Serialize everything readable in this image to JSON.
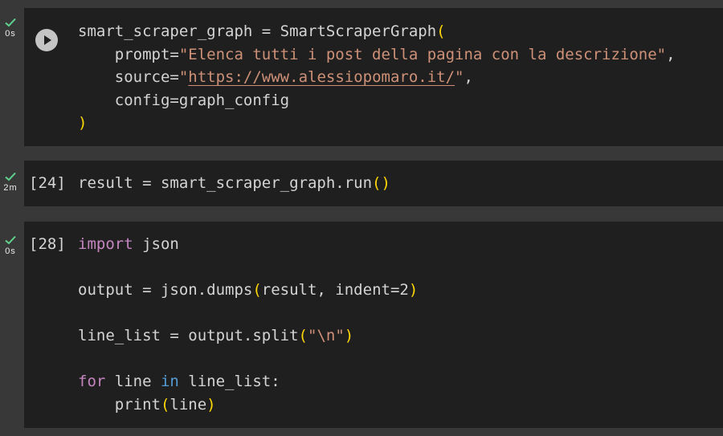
{
  "cells": [
    {
      "status": "0s",
      "exec_count": "",
      "lines": {
        "l1_var": "smart_scraper_graph",
        "l1_eq": " = ",
        "l1_cls": "SmartScraperGraph",
        "l1_paren": "(",
        "l2_arg": "    prompt=",
        "l2_str": "\"Elenca tutti i post della pagina con la descrizione\"",
        "l2_comma": ",",
        "l3_arg": "    source=",
        "l3_q1": "\"",
        "l3_url": "https://www.alessiopomaro.it/",
        "l3_q2": "\"",
        "l3_comma": ",",
        "l4": "    config=graph_config",
        "l5_paren": ")"
      }
    },
    {
      "status": "2m",
      "exec_count": "[24]",
      "lines": {
        "l1_code": "result = smart_scraper_graph.run",
        "l1_paren": "()"
      }
    },
    {
      "status": "0s",
      "exec_count": "[28]",
      "lines": {
        "l1_kw": "import",
        "l1_rest": " json",
        "l3_code": "output = json.dumps",
        "l3_p1": "(",
        "l3_args": "result, indent=2",
        "l3_p2": ")",
        "l5_code": "line_list = output.split",
        "l5_p1": "(",
        "l5_str": "\"\\n\"",
        "l5_p2": ")",
        "l7_for": "for",
        "l7_mid": " line ",
        "l7_in": "in",
        "l7_rest": " line_list:",
        "l8_code": "    print",
        "l8_p1": "(",
        "l8_arg": "line",
        "l8_p2": ")"
      }
    }
  ],
  "colors": {
    "background": "#383838",
    "editor": "#1f1f1f",
    "check": "#5fd38d",
    "string": "#ce9178",
    "keyword_control": "#c586c0",
    "keyword": "#569cd6",
    "bracket": "#ffd700"
  },
  "icons": {
    "run": "play-circle-icon",
    "status": "check-icon"
  }
}
